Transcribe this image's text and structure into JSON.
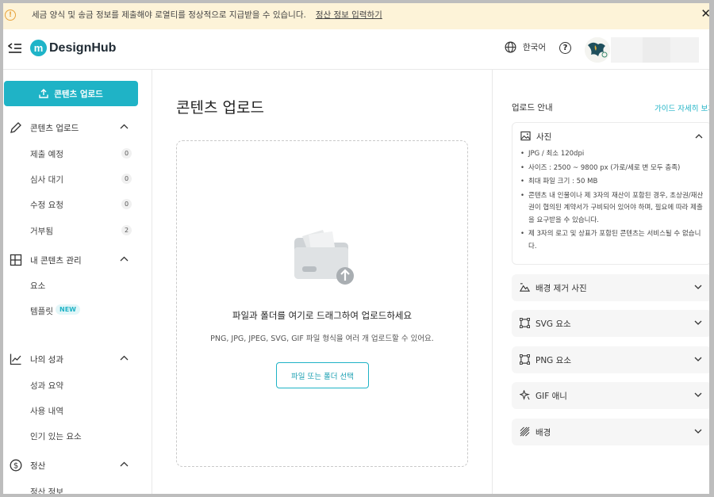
{
  "notice": {
    "message": "세금 양식 및 송금 정보를 제출해야 로열티를 정상적으로 지급받을 수 있습니다.",
    "link": "정산 정보 입력하기",
    "close": "✕"
  },
  "header": {
    "logo_mark": "m",
    "logo_text": "DesignHub",
    "language": "한국어",
    "help": "?"
  },
  "sidebar": {
    "upload_button": "콘텐츠 업로드",
    "sections": [
      {
        "label": "콘텐츠 업로드",
        "icon": "pencil-icon"
      },
      {
        "label": "내 콘텐츠 관리",
        "icon": "grid-icon"
      },
      {
        "label": "나의 성과",
        "icon": "chart-icon"
      },
      {
        "label": "정산",
        "icon": "dollar-icon"
      }
    ],
    "upload_items": [
      {
        "label": "제출 예정",
        "count": "0"
      },
      {
        "label": "심사 대기",
        "count": "0"
      },
      {
        "label": "수정 요청",
        "count": "0"
      },
      {
        "label": "거부됨",
        "count": "2"
      }
    ],
    "manage_items": [
      {
        "label": "요소"
      },
      {
        "label": "템플릿",
        "badge": "NEW"
      }
    ],
    "perf_items": [
      {
        "label": "성과 요약"
      },
      {
        "label": "사용 내역"
      },
      {
        "label": "인기 있는 요소"
      }
    ],
    "settle_items": [
      {
        "label": "정산 정보"
      }
    ]
  },
  "main": {
    "title": "콘텐츠 업로드",
    "dropzone": {
      "title": "파일과 폴더를 여기로 드래그하여 업로드하세요",
      "subtitle": "PNG, JPG, JPEG, SVG, GIF 파일 형식을 여러 개 업로드할 수 있어요.",
      "button": "파일 또는 폴더 선택"
    }
  },
  "guide": {
    "title": "업로드 안내",
    "link": "가이드 자세히 보기",
    "photo": {
      "label": "사진",
      "items": [
        "JPG / 최소 120dpi",
        "사이즈 : 2500 ~ 9800 px (가로/세로 변 모두 충족)",
        "최대 파일 크기 : 50 MB",
        "콘텐츠 내 인물이나 제 3자의 재산이 포함된 경우, 초상권/재산권이 협의된 계약서가 구비되어 있어야 하며, 필요에 따라 제출을 요구받을 수 있습니다.",
        "제 3자의 로고 및 상표가 포함된 콘텐츠는 서비스될 수 없습니다."
      ]
    },
    "sections": [
      {
        "label": "배경 제거 사진",
        "icon": "cutout-icon"
      },
      {
        "label": "SVG 요소",
        "icon": "vector-icon"
      },
      {
        "label": "PNG 요소",
        "icon": "vector-icon"
      },
      {
        "label": "GIF 애니",
        "icon": "sparkle-icon"
      },
      {
        "label": "배경",
        "icon": "pattern-icon"
      }
    ]
  },
  "colors": {
    "accent": "#1fb3c6",
    "notice_bg": "#fdf3d8",
    "warn": "#e8a33c"
  }
}
